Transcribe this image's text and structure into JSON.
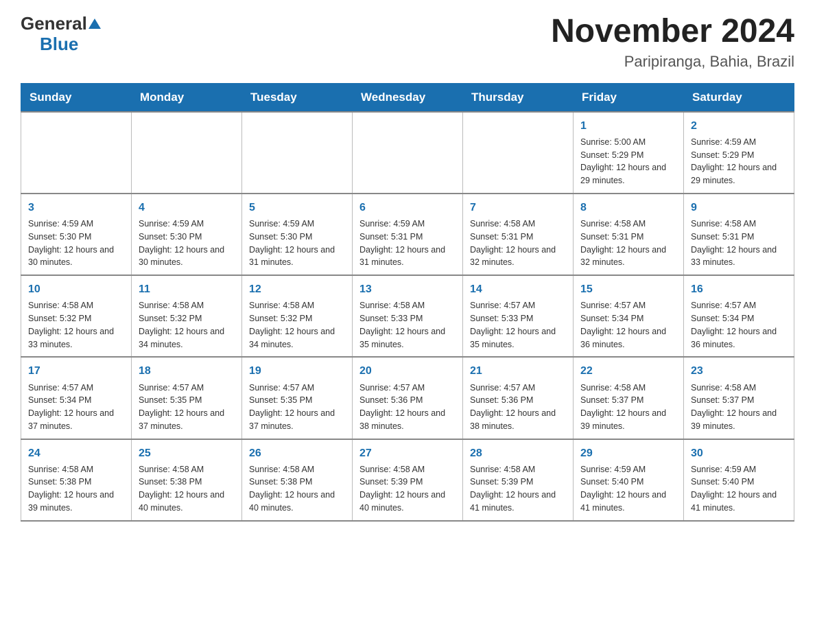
{
  "header": {
    "logo_general": "General",
    "logo_triangle": "▲",
    "logo_blue": "Blue",
    "month_title": "November 2024",
    "subtitle": "Paripiranga, Bahia, Brazil"
  },
  "weekdays": [
    "Sunday",
    "Monday",
    "Tuesday",
    "Wednesday",
    "Thursday",
    "Friday",
    "Saturday"
  ],
  "weeks": [
    [
      {
        "day": "",
        "info": ""
      },
      {
        "day": "",
        "info": ""
      },
      {
        "day": "",
        "info": ""
      },
      {
        "day": "",
        "info": ""
      },
      {
        "day": "",
        "info": ""
      },
      {
        "day": "1",
        "info": "Sunrise: 5:00 AM\nSunset: 5:29 PM\nDaylight: 12 hours and 29 minutes."
      },
      {
        "day": "2",
        "info": "Sunrise: 4:59 AM\nSunset: 5:29 PM\nDaylight: 12 hours and 29 minutes."
      }
    ],
    [
      {
        "day": "3",
        "info": "Sunrise: 4:59 AM\nSunset: 5:30 PM\nDaylight: 12 hours and 30 minutes."
      },
      {
        "day": "4",
        "info": "Sunrise: 4:59 AM\nSunset: 5:30 PM\nDaylight: 12 hours and 30 minutes."
      },
      {
        "day": "5",
        "info": "Sunrise: 4:59 AM\nSunset: 5:30 PM\nDaylight: 12 hours and 31 minutes."
      },
      {
        "day": "6",
        "info": "Sunrise: 4:59 AM\nSunset: 5:31 PM\nDaylight: 12 hours and 31 minutes."
      },
      {
        "day": "7",
        "info": "Sunrise: 4:58 AM\nSunset: 5:31 PM\nDaylight: 12 hours and 32 minutes."
      },
      {
        "day": "8",
        "info": "Sunrise: 4:58 AM\nSunset: 5:31 PM\nDaylight: 12 hours and 32 minutes."
      },
      {
        "day": "9",
        "info": "Sunrise: 4:58 AM\nSunset: 5:31 PM\nDaylight: 12 hours and 33 minutes."
      }
    ],
    [
      {
        "day": "10",
        "info": "Sunrise: 4:58 AM\nSunset: 5:32 PM\nDaylight: 12 hours and 33 minutes."
      },
      {
        "day": "11",
        "info": "Sunrise: 4:58 AM\nSunset: 5:32 PM\nDaylight: 12 hours and 34 minutes."
      },
      {
        "day": "12",
        "info": "Sunrise: 4:58 AM\nSunset: 5:32 PM\nDaylight: 12 hours and 34 minutes."
      },
      {
        "day": "13",
        "info": "Sunrise: 4:58 AM\nSunset: 5:33 PM\nDaylight: 12 hours and 35 minutes."
      },
      {
        "day": "14",
        "info": "Sunrise: 4:57 AM\nSunset: 5:33 PM\nDaylight: 12 hours and 35 minutes."
      },
      {
        "day": "15",
        "info": "Sunrise: 4:57 AM\nSunset: 5:34 PM\nDaylight: 12 hours and 36 minutes."
      },
      {
        "day": "16",
        "info": "Sunrise: 4:57 AM\nSunset: 5:34 PM\nDaylight: 12 hours and 36 minutes."
      }
    ],
    [
      {
        "day": "17",
        "info": "Sunrise: 4:57 AM\nSunset: 5:34 PM\nDaylight: 12 hours and 37 minutes."
      },
      {
        "day": "18",
        "info": "Sunrise: 4:57 AM\nSunset: 5:35 PM\nDaylight: 12 hours and 37 minutes."
      },
      {
        "day": "19",
        "info": "Sunrise: 4:57 AM\nSunset: 5:35 PM\nDaylight: 12 hours and 37 minutes."
      },
      {
        "day": "20",
        "info": "Sunrise: 4:57 AM\nSunset: 5:36 PM\nDaylight: 12 hours and 38 minutes."
      },
      {
        "day": "21",
        "info": "Sunrise: 4:57 AM\nSunset: 5:36 PM\nDaylight: 12 hours and 38 minutes."
      },
      {
        "day": "22",
        "info": "Sunrise: 4:58 AM\nSunset: 5:37 PM\nDaylight: 12 hours and 39 minutes."
      },
      {
        "day": "23",
        "info": "Sunrise: 4:58 AM\nSunset: 5:37 PM\nDaylight: 12 hours and 39 minutes."
      }
    ],
    [
      {
        "day": "24",
        "info": "Sunrise: 4:58 AM\nSunset: 5:38 PM\nDaylight: 12 hours and 39 minutes."
      },
      {
        "day": "25",
        "info": "Sunrise: 4:58 AM\nSunset: 5:38 PM\nDaylight: 12 hours and 40 minutes."
      },
      {
        "day": "26",
        "info": "Sunrise: 4:58 AM\nSunset: 5:38 PM\nDaylight: 12 hours and 40 minutes."
      },
      {
        "day": "27",
        "info": "Sunrise: 4:58 AM\nSunset: 5:39 PM\nDaylight: 12 hours and 40 minutes."
      },
      {
        "day": "28",
        "info": "Sunrise: 4:58 AM\nSunset: 5:39 PM\nDaylight: 12 hours and 41 minutes."
      },
      {
        "day": "29",
        "info": "Sunrise: 4:59 AM\nSunset: 5:40 PM\nDaylight: 12 hours and 41 minutes."
      },
      {
        "day": "30",
        "info": "Sunrise: 4:59 AM\nSunset: 5:40 PM\nDaylight: 12 hours and 41 minutes."
      }
    ]
  ]
}
